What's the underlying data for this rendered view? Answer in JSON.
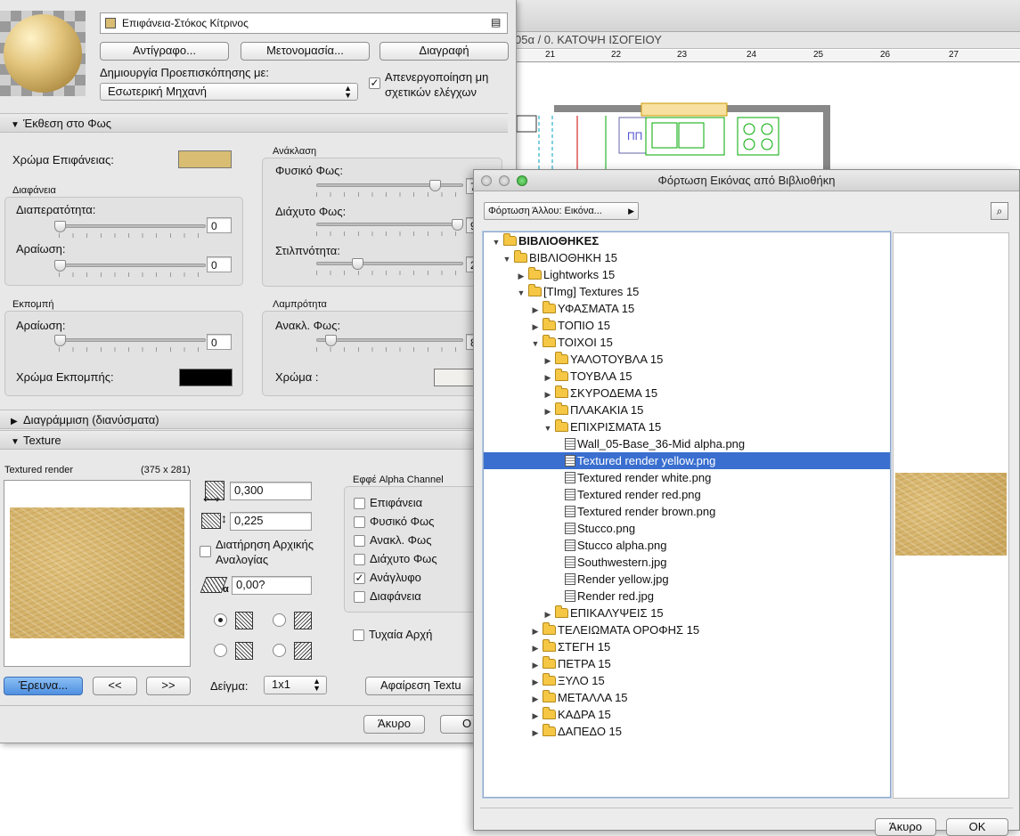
{
  "material_panel": {
    "material_name": "Επιφάνεια-Στόκος Κίτρινος",
    "buttons": {
      "copy": "Αντίγραφο...",
      "rename": "Μετονομασία...",
      "delete": "Διαγραφή"
    },
    "preview_label": "Δημιουργία Προεπισκόπησης με:",
    "preview_engine": "Εσωτερική Μηχανή",
    "disable_checks_label": "Απενεργοποίηση μη σχετικών ελέγχων",
    "light_exposure_section": "Έκθεση στο Φως",
    "surface_color_label": "Χρώμα Επιφάνειας:",
    "surface_color": "#d8bd72",
    "transparency_group": "Διαφάνεια",
    "transmittance_label": "Διαπερατότητα:",
    "transmittance_value": "0",
    "attenuation_label": "Αραίωση:",
    "attenuation_value": "0",
    "reflection_group": "Ανάκλαση",
    "ambient_label": "Φυσικό Φως:",
    "ambient_value": "7",
    "ambient_level": 0.8,
    "diffuse_label": "Διάχυτο Φως:",
    "diffuse_value": "9",
    "diffuse_level": 0.95,
    "shininess_label": "Στιλπνότητα:",
    "shininess_value": "2",
    "shininess_level": 0.27,
    "emission_group": "Εκπομπή",
    "emission_att_label": "Αραίωση:",
    "emission_att_value": "0",
    "emission_color_label": "Χρώμα Εκπομπής:",
    "emission_color": "#000000",
    "specular_group": "Λαμπρότητα",
    "specular_label": "Ανακλ. Φως:",
    "specular_value": "8",
    "specular_level": 0.09,
    "specular_color_label": "Χρώμα :",
    "specular_color": "#f2f0ec",
    "hatching_section": "Διαγράμμιση (διανύσματα)",
    "texture_section": "Texture",
    "texture_name": "Textured render",
    "texture_size": "(375 x 281)",
    "width_value": "0,300",
    "height_value": "0,225",
    "keep_ratio_label": "Διατήρηση Αρχικής Αναλογίας",
    "angle_value": "0,00?",
    "alpha_group": "Εφφέ  Alpha Channel",
    "alpha_options": [
      {
        "label": "Επιφάνεια",
        "checked": false
      },
      {
        "label": "Φυσικό Φως",
        "checked": false
      },
      {
        "label": "Ανακλ. Φως",
        "checked": false
      },
      {
        "label": "Διάχυτο Φως",
        "checked": false
      },
      {
        "label": "Ανάγλυφο",
        "checked": true
      },
      {
        "label": "Διαφάνεια",
        "checked": false
      }
    ],
    "random_origin_label": "Τυχαία Αρχή",
    "search_button": "Έρευνα...",
    "prev_button": "<<",
    "next_button": ">>",
    "sample_label": "Δείγμα:",
    "sample_value": "1x1",
    "remove_texture_button": "Αφαίρεση Textu",
    "cancel_button": "Άκυρο",
    "ok_button": "O"
  },
  "background_window": {
    "breadcrumb": "05α / 0. ΚΑΤΟΨΗ ΙΣΟΓΕΙΟΥ",
    "ruler": [
      "21",
      "22",
      "23",
      "24",
      "25",
      "26",
      "27"
    ],
    "plan_label": "ΠΠ"
  },
  "library_dialog": {
    "title": "Φόρτωση Εικόνας από Βιβλιοθήκη",
    "load_other": "Φόρτωση Άλλου: Εικόνα...",
    "tree": [
      {
        "label": "ΒΙΒΛΙΟΘΗΚΕΣ",
        "type": "folder",
        "open": true,
        "bold": true
      },
      {
        "label": "ΒΙΒΛΙΟΘΗΚΗ 15",
        "type": "folder",
        "open": true
      },
      {
        "label": "Lightworks 15",
        "type": "folder",
        "open": false
      },
      {
        "label": "[TImg] Textures 15",
        "type": "folder",
        "open": true
      },
      {
        "label": "ΥΦΑΣΜΑΤΑ 15",
        "type": "folder",
        "open": false
      },
      {
        "label": "ΤΟΠΙΟ 15",
        "type": "folder",
        "open": false
      },
      {
        "label": "ΤΟΙΧΟΙ 15",
        "type": "folder",
        "open": true
      },
      {
        "label": "ΥΑΛΟΤΟΥΒΛΑ 15",
        "type": "folder",
        "open": false
      },
      {
        "label": "ΤΟΥΒΛΑ 15",
        "type": "folder",
        "open": false
      },
      {
        "label": "ΣΚΥΡΟΔΕΜΑ 15",
        "type": "folder",
        "open": false
      },
      {
        "label": "ΠΛΑΚΑΚΙΑ 15",
        "type": "folder",
        "open": false
      },
      {
        "label": "ΕΠΙΧΡΙΣΜΑΤΑ 15",
        "type": "folder",
        "open": true
      },
      {
        "label": "Wall_05-Base_36-Mid alpha.png",
        "type": "file"
      },
      {
        "label": "Textured render yellow.png",
        "type": "file",
        "selected": true
      },
      {
        "label": "Textured render white.png",
        "type": "file"
      },
      {
        "label": "Textured render red.png",
        "type": "file"
      },
      {
        "label": "Textured render brown.png",
        "type": "file"
      },
      {
        "label": "Stucco.png",
        "type": "file"
      },
      {
        "label": "Stucco alpha.png",
        "type": "file"
      },
      {
        "label": "Southwestern.jpg",
        "type": "file"
      },
      {
        "label": "Render yellow.jpg",
        "type": "file"
      },
      {
        "label": "Render red.jpg",
        "type": "file"
      },
      {
        "label": "ΕΠΙΚΑΛΥΨΕΙΣ 15",
        "type": "folder",
        "open": false
      },
      {
        "label": "ΤΕΛΕΙΩΜΑΤΑ ΟΡΟΦΗΣ 15",
        "type": "folder",
        "open": false
      },
      {
        "label": "ΣΤΕΓΗ 15",
        "type": "folder",
        "open": false
      },
      {
        "label": "ΠΕΤΡΑ 15",
        "type": "folder",
        "open": false
      },
      {
        "label": "ΞΥΛΟ 15",
        "type": "folder",
        "open": false
      },
      {
        "label": "ΜΕΤΑΛΛΑ 15",
        "type": "folder",
        "open": false
      },
      {
        "label": "ΚΑΔΡΑ 15",
        "type": "folder",
        "open": false
      },
      {
        "label": "ΔΑΠΕΔΟ 15",
        "type": "folder",
        "open": false
      }
    ],
    "cancel_button": "Άκυρο",
    "ok_button": "OK"
  }
}
